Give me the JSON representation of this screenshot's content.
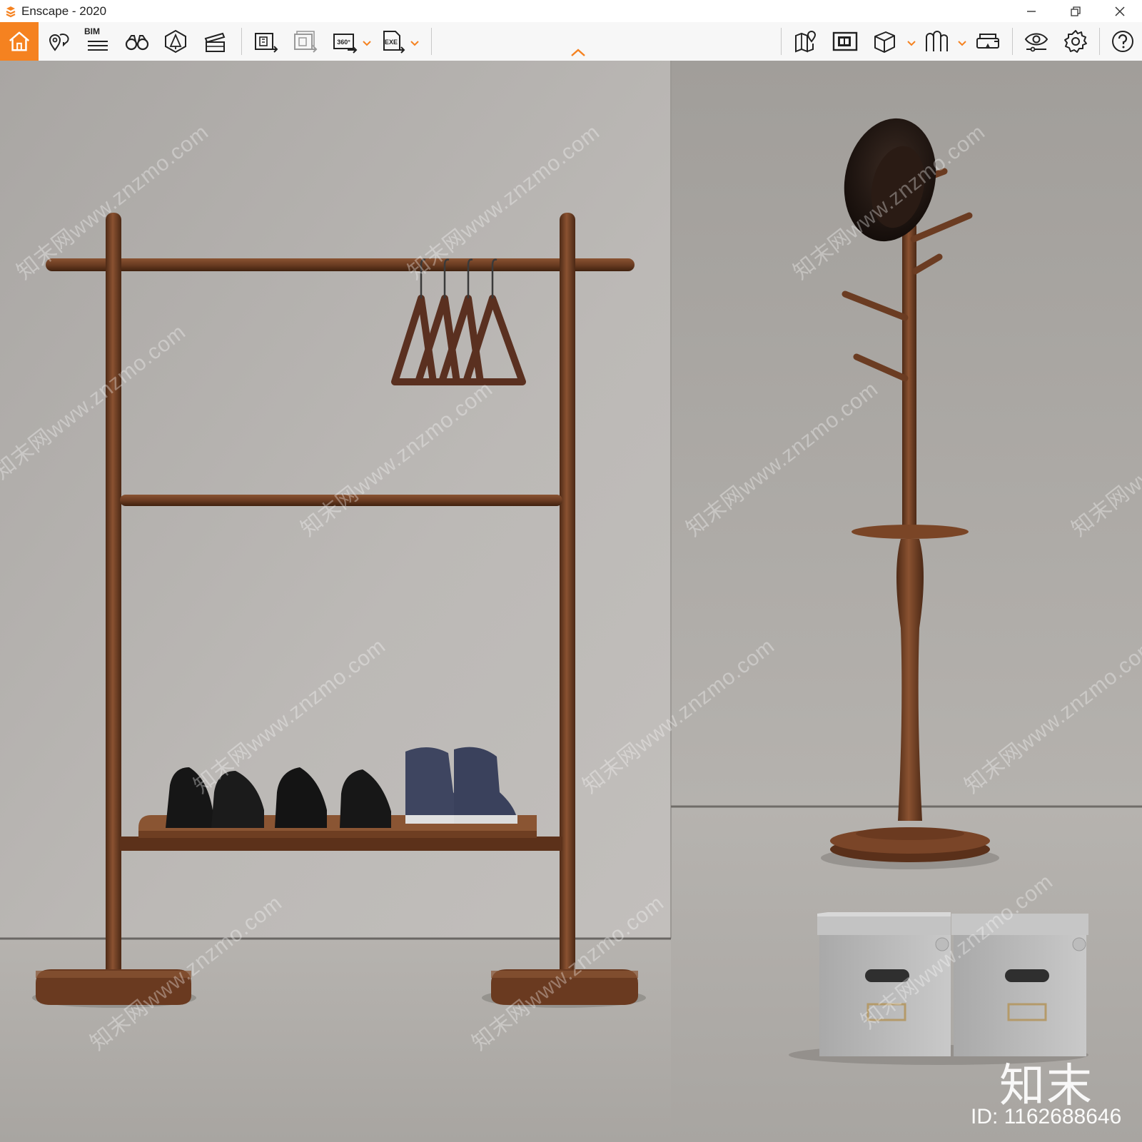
{
  "window": {
    "title": "Enscape - 2020",
    "controls": [
      "minimize",
      "restore",
      "close"
    ]
  },
  "toolbar": {
    "accent_color": "#f58220",
    "bim_label": "BIM",
    "left_tools": [
      {
        "id": "home",
        "icon": "home-icon",
        "active": true
      },
      {
        "id": "views",
        "icon": "location-pins-icon"
      },
      {
        "id": "bim",
        "icon": "bim-list-icon"
      },
      {
        "id": "explorer",
        "icon": "binoculars-icon"
      },
      {
        "id": "assets",
        "icon": "asset-library-icon"
      },
      {
        "id": "video",
        "icon": "clapperboard-icon"
      },
      {
        "id": "render",
        "icon": "render-image-icon"
      },
      {
        "id": "batch",
        "icon": "batch-render-icon"
      },
      {
        "id": "panorama",
        "icon": "panorama-360-icon",
        "label": "360°",
        "dropdown": true
      },
      {
        "id": "export",
        "icon": "export-exe-icon",
        "label": "EXE",
        "dropdown": true
      }
    ],
    "right_tools": [
      {
        "id": "map",
        "icon": "map-icon"
      },
      {
        "id": "sync",
        "icon": "sync-views-icon"
      },
      {
        "id": "cube",
        "icon": "cube-icon",
        "dropdown": true
      },
      {
        "id": "atmosphere",
        "icon": "atmosphere-icon",
        "dropdown": true
      },
      {
        "id": "vr",
        "icon": "vr-headset-icon"
      },
      {
        "id": "visual",
        "icon": "eye-settings-icon"
      },
      {
        "id": "settings",
        "icon": "gear-icon"
      },
      {
        "id": "help",
        "icon": "help-icon"
      }
    ]
  },
  "viewport": {
    "wall_color": "#b6b2ae",
    "floor_color": "#aaa6a1",
    "wood_color": "#6b3c22",
    "watermark_text": "知末网www.znzmo.com",
    "logo_mark": "知末",
    "id_mark": "ID: 1162688646"
  }
}
